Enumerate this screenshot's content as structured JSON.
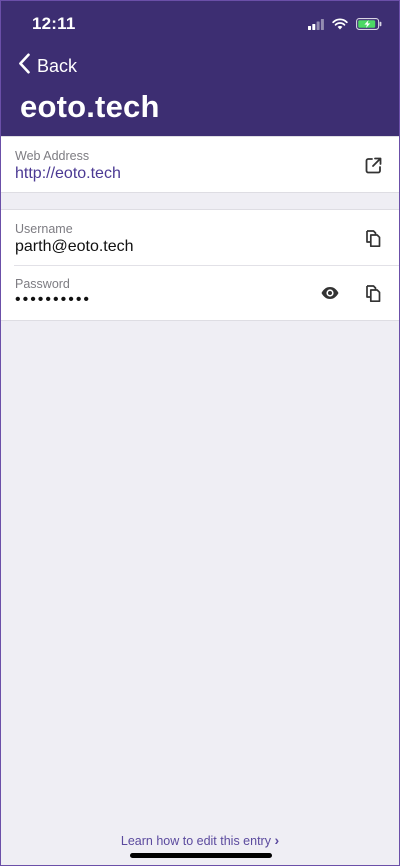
{
  "status_bar": {
    "time": "12:11"
  },
  "nav": {
    "back_label": "Back",
    "title": "eoto.tech"
  },
  "web_address": {
    "label": "Web Address",
    "value": "http://eoto.tech"
  },
  "username": {
    "label": "Username",
    "value": "parth@eoto.tech"
  },
  "password": {
    "label": "Password",
    "value": "••••••••••"
  },
  "footer": {
    "link_text": "Learn how to edit this entry",
    "chevron": "›"
  },
  "colors": {
    "header_bg": "#3d2e72",
    "accent": "#4b3993",
    "background": "#efeef4",
    "battery_charging": "#4cd964"
  },
  "icons": {
    "external_link": "external-link-icon",
    "copy": "copy-icon",
    "reveal": "eye-icon",
    "back": "chevron-left-icon"
  }
}
